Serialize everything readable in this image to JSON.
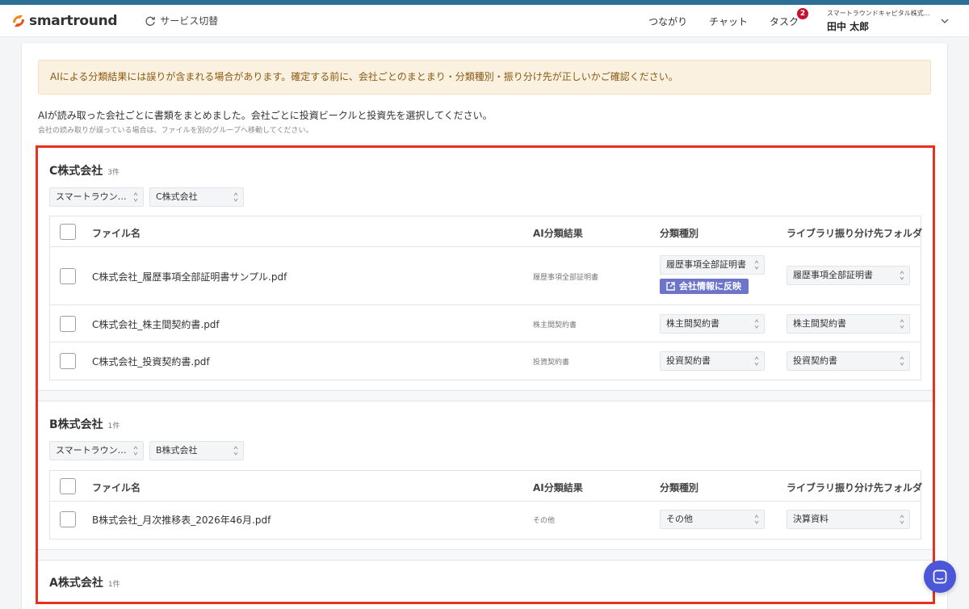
{
  "header": {
    "logo_text": "smartround",
    "service_switch": "サービス切替",
    "nav": [
      "つながり",
      "チャット",
      "タスク"
    ],
    "task_badge": "2",
    "user_org": "スマートラウンドキャピタル株式…",
    "user_name": "田中 太郎",
    "accent": "#2e6f96"
  },
  "warning": "AIによる分類結果には誤りが含まれる場合があります。確定する前に、会社ごとのまとまり・分類種別・振り分け先が正しいかご確認ください。",
  "intro": "AIが読み取った会社ごとに書類をまとめました。会社ごとに投資ビークルと投資先を選択してください。",
  "intro_sub": "会社の読み取りが誤っている場合は、ファイルを別のグループへ移動してください。",
  "columns": {
    "file": "ファイル名",
    "ai": "AI分類結果",
    "type": "分類種別",
    "folder": "ライブラリ振り分け先フォルダ"
  },
  "reflect_label": "会社情報に反映",
  "groups": [
    {
      "name": "C株式会社",
      "count": "3件",
      "vehicle": "スマートラウン…",
      "company": "C株式会社",
      "files": [
        {
          "name": "C株式会社_履歴事項全部証明書サンプル.pdf",
          "ai": "履歴事項全部証明書",
          "type": "履歴事項全部証明書",
          "folder": "履歴事項全部証明書"
        },
        {
          "name": "C株式会社_株主間契約書.pdf",
          "ai": "株主間契約書",
          "type": "株主間契約書",
          "folder": "株主間契約書"
        },
        {
          "name": "C株式会社_投資契約書.pdf",
          "ai": "投資契約書",
          "type": "投資契約書",
          "folder": "投資契約書"
        }
      ]
    },
    {
      "name": "B株式会社",
      "count": "1件",
      "vehicle": "スマートラウン…",
      "company": "B株式会社",
      "files": [
        {
          "name": "B株式会社_月次推移表_2026年46月.pdf",
          "ai": "その他",
          "type": "その他",
          "folder": "決算資料"
        }
      ]
    },
    {
      "name": "A株式会社",
      "count": "1件"
    }
  ]
}
